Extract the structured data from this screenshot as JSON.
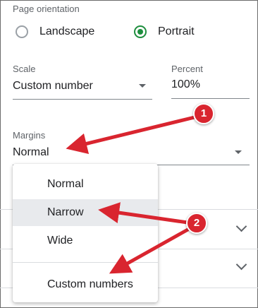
{
  "orientation": {
    "label": "Page orientation",
    "options": [
      {
        "label": "Landscape",
        "selected": false
      },
      {
        "label": "Portrait",
        "selected": true
      }
    ]
  },
  "scale": {
    "label": "Scale",
    "value": "Custom number"
  },
  "percent": {
    "label": "Percent",
    "value": "100%"
  },
  "margins": {
    "label": "Margins",
    "value": "Normal",
    "menu": [
      {
        "label": "Normal",
        "selected": false
      },
      {
        "label": "Narrow",
        "selected": true
      },
      {
        "label": "Wide",
        "selected": false
      },
      {
        "label": "Custom numbers",
        "selected": false
      }
    ]
  },
  "annotations": {
    "badge_1": "1",
    "badge_2": "2"
  },
  "colors": {
    "accent": "#1e8e3e",
    "annotation": "#d9252f"
  }
}
